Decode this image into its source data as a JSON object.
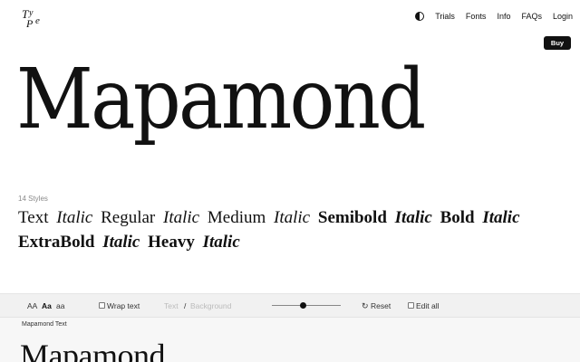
{
  "header": {
    "logo_text": "TyPe",
    "nav": [
      "Trials",
      "Fonts",
      "Info",
      "FAQs",
      "Login"
    ],
    "buy_label": "Buy",
    "contrast_icon": "contrast-icon"
  },
  "hero": {
    "title": "Mapamond",
    "styles_count": "14 Styles",
    "styles_line1": [
      {
        "text": "Text",
        "style": "regular"
      },
      {
        "text": "Italic",
        "style": "italic"
      },
      {
        "text": "Regular",
        "style": "regular"
      },
      {
        "text": "Italic",
        "style": "italic"
      },
      {
        "text": "Medium",
        "style": "regular"
      },
      {
        "text": "Italic",
        "style": "italic"
      },
      {
        "text": "Semibold",
        "style": "bold"
      },
      {
        "text": "Italic",
        "style": "bold-italic"
      },
      {
        "text": "Bold",
        "style": "bold"
      },
      {
        "text": "Italic",
        "style": "bold-italic"
      }
    ],
    "styles_line2": [
      {
        "text": "ExtraBold",
        "style": "bold"
      },
      {
        "text": "Italic",
        "style": "bold-italic"
      },
      {
        "text": "Heavy",
        "style": "bold"
      },
      {
        "text": "Italic",
        "style": "bold-italic"
      }
    ]
  },
  "toolbar": {
    "case_upper": "AA",
    "case_title": "Aa",
    "case_lower": "aa",
    "wrap_label": "Wrap text",
    "wrap_checked": false,
    "text_color_placeholder": "Text",
    "separator": "/",
    "background_placeholder": "Background",
    "size_slider": 0.45,
    "reset_label": "Reset",
    "edit_all_label": "Edit all",
    "edit_all_checked": false
  },
  "specimen": {
    "label": "Mapamond Text",
    "sample": "Mapamond"
  },
  "colors": {
    "background": "#ffffff",
    "text": "#111111",
    "toolbar_bg": "#f1f1f1",
    "muted": "#8a8a8a",
    "buy_bg": "#111111"
  }
}
